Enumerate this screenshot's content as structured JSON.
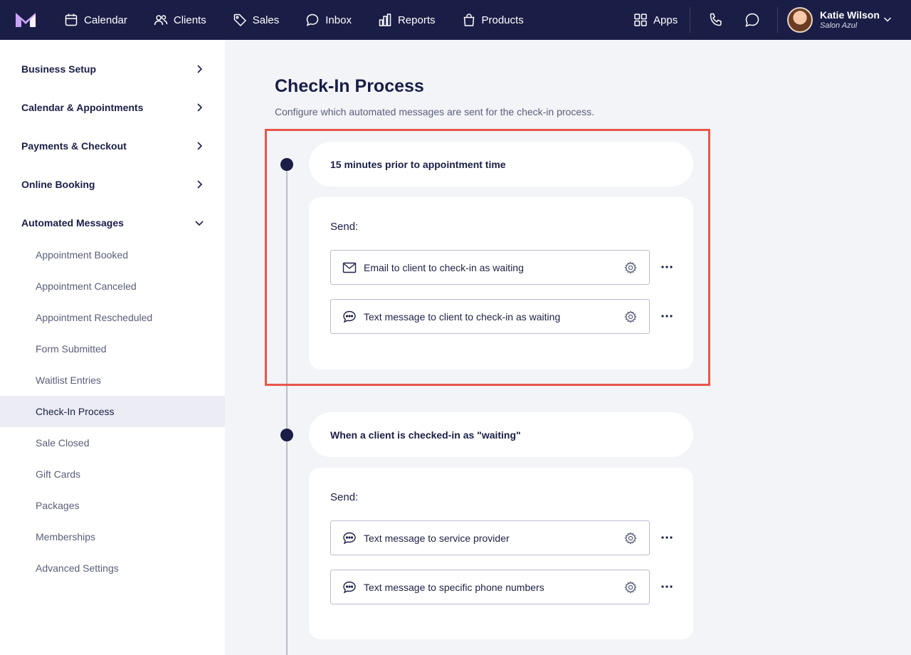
{
  "nav": {
    "items": [
      {
        "label": "Calendar",
        "icon": "calendar-icon"
      },
      {
        "label": "Clients",
        "icon": "users-icon"
      },
      {
        "label": "Sales",
        "icon": "tag-icon"
      },
      {
        "label": "Inbox",
        "icon": "inbox-icon"
      },
      {
        "label": "Reports",
        "icon": "bar-chart-icon"
      },
      {
        "label": "Products",
        "icon": "shopping-bag-icon"
      }
    ],
    "apps_label": "Apps",
    "user": {
      "name": "Katie Wilson",
      "salon": "Salon Azul"
    },
    "colors": {
      "bar": "#1a1e46",
      "highlight": "#e8574a"
    }
  },
  "sidebar": {
    "sections": [
      {
        "label": "Business Setup",
        "expanded": false
      },
      {
        "label": "Calendar & Appointments",
        "expanded": false
      },
      {
        "label": "Payments & Checkout",
        "expanded": false
      },
      {
        "label": "Online Booking",
        "expanded": false
      },
      {
        "label": "Automated Messages",
        "expanded": true
      }
    ],
    "subitems": [
      {
        "label": "Appointment Booked"
      },
      {
        "label": "Appointment Canceled"
      },
      {
        "label": "Appointment Rescheduled"
      },
      {
        "label": "Form Submitted"
      },
      {
        "label": "Waitlist Entries"
      },
      {
        "label": "Check-In Process",
        "active": true
      },
      {
        "label": "Sale Closed"
      },
      {
        "label": "Gift Cards"
      },
      {
        "label": "Packages"
      },
      {
        "label": "Memberships"
      },
      {
        "label": "Advanced Settings"
      }
    ]
  },
  "main": {
    "title": "Check-In Process",
    "subtitle": "Configure which automated messages are sent for the check-in process.",
    "steps": [
      {
        "trigger": "15 minutes prior to appointment time",
        "send_label": "Send:",
        "messages": [
          {
            "label": "Email to client to check-in as waiting",
            "icon": "envelope-icon"
          },
          {
            "label": "Text message to client to check-in as waiting",
            "icon": "chat-bubble-icon"
          }
        ]
      },
      {
        "trigger": "When a client is checked-in as \"waiting\"",
        "send_label": "Send:",
        "messages": [
          {
            "label": "Text message to service provider",
            "icon": "chat-bubble-icon"
          },
          {
            "label": "Text message to specific phone numbers",
            "icon": "chat-bubble-icon"
          }
        ]
      }
    ]
  }
}
